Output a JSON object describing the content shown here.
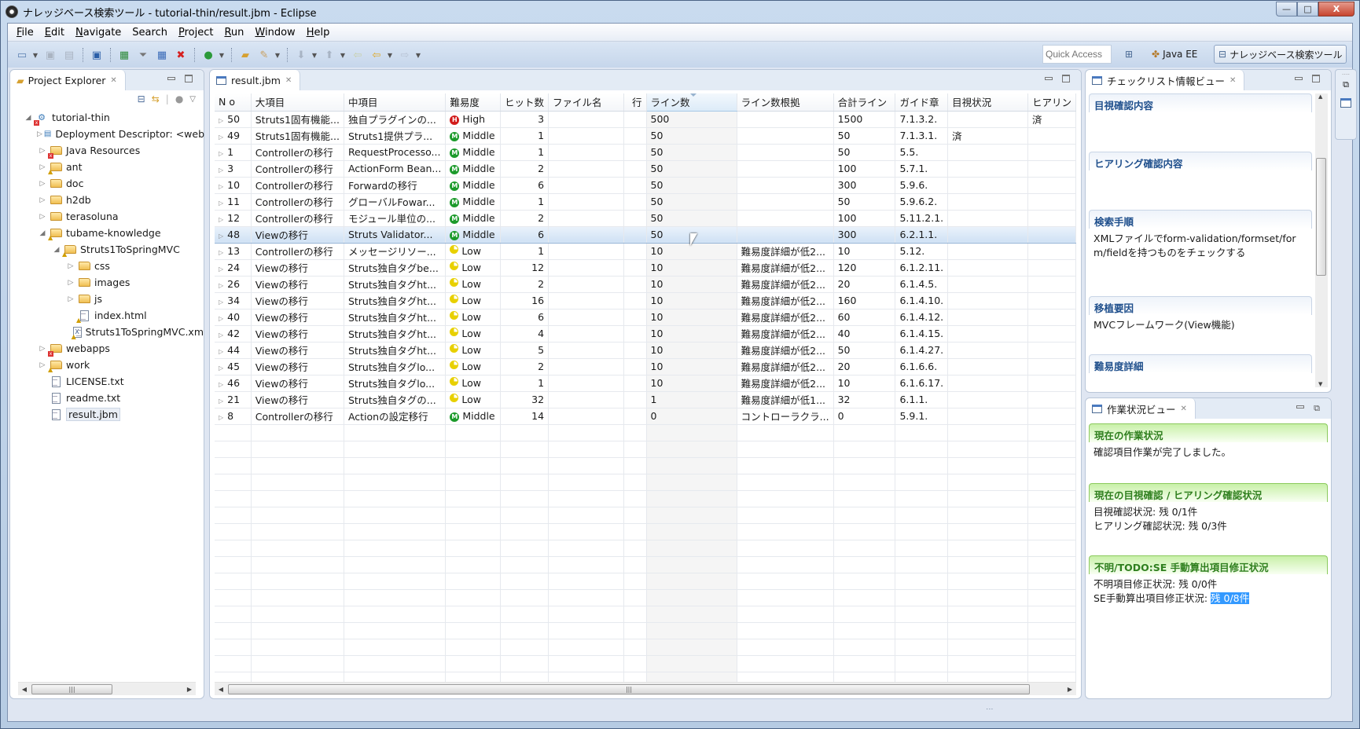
{
  "window": {
    "title": "ナレッジベース検索ツール - tutorial-thin/result.jbm - Eclipse",
    "controls": {
      "minimize": "—",
      "maximize": "□",
      "close": "X"
    }
  },
  "menu": [
    {
      "label": "File",
      "mnemonic": "F",
      "rest": "ile"
    },
    {
      "label": "Edit",
      "mnemonic": "E",
      "rest": "dit"
    },
    {
      "label": "Navigate",
      "mnemonic": "N",
      "rest": "avigate"
    },
    {
      "label": "Search",
      "mnemonic": "",
      "rest": "Search"
    },
    {
      "label": "Project",
      "mnemonic": "P",
      "rest": "roject"
    },
    {
      "label": "Run",
      "mnemonic": "R",
      "rest": "un"
    },
    {
      "label": "Window",
      "mnemonic": "W",
      "rest": "indow"
    },
    {
      "label": "Help",
      "mnemonic": "H",
      "rest": "elp"
    }
  ],
  "toolbar": {
    "icons": [
      "new-icon",
      "save-icon",
      "save-all-icon",
      "monitor-icon",
      "excel-export-icon",
      "filter-icon",
      "calendar-import-icon",
      "delete-table-icon",
      "run-icon",
      "open-folder-icon",
      "brush-icon",
      "next-annotation-icon",
      "prev-annotation-icon",
      "back-history-icon",
      "back-icon",
      "forward-icon"
    ],
    "quick_access_placeholder": "Quick Access",
    "perspectives": [
      {
        "label": "Java EE",
        "active": false
      },
      {
        "label": "ナレッジベース検索ツール",
        "active": true
      }
    ]
  },
  "project_explorer": {
    "title": "Project Explorer",
    "tree": [
      {
        "label": "tutorial-thin",
        "depth": 0,
        "twisty": "open",
        "icon": "project"
      },
      {
        "label": "Deployment Descriptor: <web",
        "depth": 1,
        "twisty": "closed",
        "icon": "descriptor"
      },
      {
        "label": "Java Resources",
        "depth": 1,
        "twisty": "closed",
        "icon": "java-resources"
      },
      {
        "label": "ant",
        "depth": 1,
        "twisty": "closed",
        "icon": "folder-warn"
      },
      {
        "label": "doc",
        "depth": 1,
        "twisty": "closed",
        "icon": "folder"
      },
      {
        "label": "h2db",
        "depth": 1,
        "twisty": "closed",
        "icon": "folder"
      },
      {
        "label": "terasoluna",
        "depth": 1,
        "twisty": "closed",
        "icon": "folder"
      },
      {
        "label": "tubame-knowledge",
        "depth": 1,
        "twisty": "open",
        "icon": "folder-warn"
      },
      {
        "label": "Struts1ToSpringMVC",
        "depth": 2,
        "twisty": "open",
        "icon": "folder-warn"
      },
      {
        "label": "css",
        "depth": 3,
        "twisty": "closed",
        "icon": "folder"
      },
      {
        "label": "images",
        "depth": 3,
        "twisty": "closed",
        "icon": "folder"
      },
      {
        "label": "js",
        "depth": 3,
        "twisty": "closed",
        "icon": "folder"
      },
      {
        "label": "index.html",
        "depth": 3,
        "twisty": "none",
        "icon": "file-warn"
      },
      {
        "label": "Struts1ToSpringMVC.xm",
        "depth": 3,
        "twisty": "none",
        "icon": "xml-warn"
      },
      {
        "label": "webapps",
        "depth": 1,
        "twisty": "closed",
        "icon": "folder-error"
      },
      {
        "label": "work",
        "depth": 1,
        "twisty": "closed",
        "icon": "folder-warn"
      },
      {
        "label": "LICENSE.txt",
        "depth": 1,
        "twisty": "none",
        "icon": "file"
      },
      {
        "label": "readme.txt",
        "depth": 1,
        "twisty": "none",
        "icon": "file"
      },
      {
        "label": "result.jbm",
        "depth": 1,
        "twisty": "none",
        "icon": "file",
        "selected": true
      }
    ]
  },
  "editor": {
    "tab": "result.jbm",
    "columns": [
      "N o",
      "大項目",
      "中項目",
      "難易度",
      "ヒット数",
      "ファイル名",
      "行",
      "ライン数",
      "ライン数根拠",
      "合計ライン",
      "ガイド章",
      "目視状況",
      "ヒアリン"
    ],
    "sorted_column": "ライン数",
    "rows": [
      {
        "no": "50",
        "major": "Struts1固有機能...",
        "middle": "独自プラグインの...",
        "difficulty": "High",
        "hits": "3",
        "file": "",
        "line": "",
        "lines": "500",
        "basis": "",
        "total": "1500",
        "guide": "7.1.3.2.",
        "visual": "",
        "hearing": "済"
      },
      {
        "no": "49",
        "major": "Struts1固有機能...",
        "middle": "Struts1提供プラ...",
        "difficulty": "Middle",
        "hits": "1",
        "file": "",
        "line": "",
        "lines": "50",
        "basis": "",
        "total": "50",
        "guide": "7.1.3.1.",
        "visual": "済",
        "hearing": ""
      },
      {
        "no": "1",
        "major": "Controllerの移行",
        "middle": "RequestProcesso...",
        "difficulty": "Middle",
        "hits": "1",
        "file": "",
        "line": "",
        "lines": "50",
        "basis": "",
        "total": "50",
        "guide": "5.5.",
        "visual": "",
        "hearing": ""
      },
      {
        "no": "3",
        "major": "Controllerの移行",
        "middle": "ActionForm Bean...",
        "difficulty": "Middle",
        "hits": "2",
        "file": "",
        "line": "",
        "lines": "50",
        "basis": "",
        "total": "100",
        "guide": "5.7.1.",
        "visual": "",
        "hearing": ""
      },
      {
        "no": "10",
        "major": "Controllerの移行",
        "middle": "Forwardの移行",
        "difficulty": "Middle",
        "hits": "6",
        "file": "",
        "line": "",
        "lines": "50",
        "basis": "",
        "total": "300",
        "guide": "5.9.6.",
        "visual": "",
        "hearing": ""
      },
      {
        "no": "11",
        "major": "Controllerの移行",
        "middle": "グローバルFowar...",
        "difficulty": "Middle",
        "hits": "1",
        "file": "",
        "line": "",
        "lines": "50",
        "basis": "",
        "total": "50",
        "guide": "5.9.6.2.",
        "visual": "",
        "hearing": ""
      },
      {
        "no": "12",
        "major": "Controllerの移行",
        "middle": "モジュール単位の...",
        "difficulty": "Middle",
        "hits": "2",
        "file": "",
        "line": "",
        "lines": "50",
        "basis": "",
        "total": "100",
        "guide": "5.11.2.1.",
        "visual": "",
        "hearing": ""
      },
      {
        "no": "48",
        "major": "Viewの移行",
        "middle": "Struts Validator...",
        "difficulty": "Middle",
        "hits": "6",
        "file": "",
        "line": "",
        "lines": "50",
        "basis": "",
        "total": "300",
        "guide": "6.2.1.1.",
        "visual": "",
        "hearing": "",
        "selected": true
      },
      {
        "no": "13",
        "major": "Controllerの移行",
        "middle": "メッセージリソー...",
        "difficulty": "Low",
        "hits": "1",
        "file": "",
        "line": "",
        "lines": "10",
        "basis": "難易度詳細が低2...",
        "total": "10",
        "guide": "5.12.",
        "visual": "",
        "hearing": ""
      },
      {
        "no": "24",
        "major": "Viewの移行",
        "middle": "Struts独自タグbe...",
        "difficulty": "Low",
        "hits": "12",
        "file": "",
        "line": "",
        "lines": "10",
        "basis": "難易度詳細が低2...",
        "total": "120",
        "guide": "6.1.2.11.",
        "visual": "",
        "hearing": ""
      },
      {
        "no": "26",
        "major": "Viewの移行",
        "middle": "Struts独自タグht...",
        "difficulty": "Low",
        "hits": "2",
        "file": "",
        "line": "",
        "lines": "10",
        "basis": "難易度詳細が低2...",
        "total": "20",
        "guide": "6.1.4.5.",
        "visual": "",
        "hearing": ""
      },
      {
        "no": "34",
        "major": "Viewの移行",
        "middle": "Struts独自タグht...",
        "difficulty": "Low",
        "hits": "16",
        "file": "",
        "line": "",
        "lines": "10",
        "basis": "難易度詳細が低2...",
        "total": "160",
        "guide": "6.1.4.10.",
        "visual": "",
        "hearing": ""
      },
      {
        "no": "40",
        "major": "Viewの移行",
        "middle": "Struts独自タグht...",
        "difficulty": "Low",
        "hits": "6",
        "file": "",
        "line": "",
        "lines": "10",
        "basis": "難易度詳細が低2...",
        "total": "60",
        "guide": "6.1.4.12.",
        "visual": "",
        "hearing": ""
      },
      {
        "no": "42",
        "major": "Viewの移行",
        "middle": "Struts独自タグht...",
        "difficulty": "Low",
        "hits": "4",
        "file": "",
        "line": "",
        "lines": "10",
        "basis": "難易度詳細が低2...",
        "total": "40",
        "guide": "6.1.4.15.",
        "visual": "",
        "hearing": ""
      },
      {
        "no": "44",
        "major": "Viewの移行",
        "middle": "Struts独自タグht...",
        "difficulty": "Low",
        "hits": "5",
        "file": "",
        "line": "",
        "lines": "10",
        "basis": "難易度詳細が低2...",
        "total": "50",
        "guide": "6.1.4.27.",
        "visual": "",
        "hearing": ""
      },
      {
        "no": "45",
        "major": "Viewの移行",
        "middle": "Struts独自タグlo...",
        "difficulty": "Low",
        "hits": "2",
        "file": "",
        "line": "",
        "lines": "10",
        "basis": "難易度詳細が低2...",
        "total": "20",
        "guide": "6.1.6.6.",
        "visual": "",
        "hearing": ""
      },
      {
        "no": "46",
        "major": "Viewの移行",
        "middle": "Struts独自タグlo...",
        "difficulty": "Low",
        "hits": "1",
        "file": "",
        "line": "",
        "lines": "10",
        "basis": "難易度詳細が低2...",
        "total": "10",
        "guide": "6.1.6.17.",
        "visual": "",
        "hearing": ""
      },
      {
        "no": "21",
        "major": "Viewの移行",
        "middle": "Struts独自タグの...",
        "difficulty": "Low",
        "hits": "32",
        "file": "",
        "line": "",
        "lines": "1",
        "basis": "難易度詳細が低1...",
        "total": "32",
        "guide": "6.1.1.",
        "visual": "",
        "hearing": ""
      },
      {
        "no": "8",
        "major": "Controllerの移行",
        "middle": "Actionの設定移行",
        "difficulty": "Middle",
        "hits": "14",
        "file": "",
        "line": "",
        "lines": "0",
        "basis": "コントローラクラ...",
        "total": "0",
        "guide": "5.9.1.",
        "visual": "",
        "hearing": ""
      }
    ]
  },
  "checklist_view": {
    "title": "チェックリスト情報ビュー",
    "sections": [
      {
        "heading": "目視確認内容",
        "body": ""
      },
      {
        "heading": "ヒアリング確認内容",
        "body": ""
      },
      {
        "heading": "検索手順",
        "body": "XMLファイルでform-validation/formset/form/fieldを持つものをチェックする"
      },
      {
        "heading": "移植要因",
        "body": "MVCフレームワーク(View機能)"
      },
      {
        "heading": "難易度詳細",
        "body": ""
      }
    ]
  },
  "work_status_view": {
    "title": "作業状況ビュー",
    "current": {
      "heading": "現在の作業状況",
      "text": "確認項目作業が完了しました。"
    },
    "visual_hearing": {
      "heading": "現在の目視確認 / ヒアリング確認状況",
      "visual_label": "目視確認状況: ",
      "visual_value": "残 0/1件",
      "hearing_label": "ヒアリング確認状況: ",
      "hearing_value": "残 0/3件"
    },
    "todo": {
      "heading": "不明/TODO:SE 手動算出項目修正状況",
      "unknown_label": "不明項目修正状況: ",
      "unknown_value": "残 0/0件",
      "se_label": "SE手動算出項目修正状況: ",
      "se_value": "残 0/8件"
    }
  },
  "colors": {
    "high": "#d21c1c",
    "middle": "#1c9a2b",
    "low": "#e8d000",
    "section_blue": "#1f4f8c",
    "section_green": "#2f7f1e",
    "selection": "#3399ff"
  }
}
